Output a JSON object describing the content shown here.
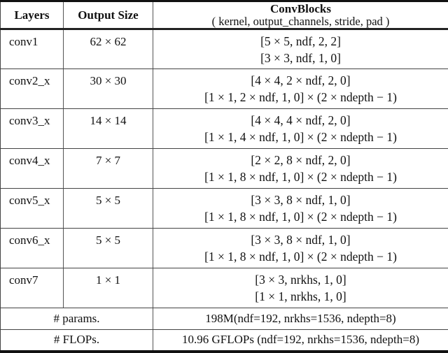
{
  "table": {
    "headers": {
      "layers": "Layers",
      "output_size": "Output Size",
      "convblocks_title": "ConvBlocks",
      "convblocks_subtitle": "( kernel, output_channels, stride, pad )"
    },
    "rows": [
      {
        "layer": "conv1",
        "output_size": "62 × 62",
        "blocks": [
          "[5 × 5, ndf, 2, 2]",
          "[3 × 3, ndf, 1, 0]"
        ]
      },
      {
        "layer": "conv2_x",
        "output_size": "30 × 30",
        "blocks": [
          "[4 × 4, 2 × ndf, 2, 0]",
          "[1 × 1, 2 × ndf, 1, 0] × (2 × ndepth − 1)"
        ]
      },
      {
        "layer": "conv3_x",
        "output_size": "14 × 14",
        "blocks": [
          "[4 × 4, 4 × ndf, 2, 0]",
          "[1 × 1, 4 × ndf, 1, 0] × (2 × ndepth − 1)"
        ]
      },
      {
        "layer": "conv4_x",
        "output_size": "7 × 7",
        "blocks": [
          "[2 × 2, 8 × ndf, 2, 0]",
          "[1 × 1, 8 × ndf, 1, 0] × (2 × ndepth − 1)"
        ]
      },
      {
        "layer": "conv5_x",
        "output_size": "5 × 5",
        "blocks": [
          "[3 × 3, 8 × ndf, 1, 0]",
          "[1 × 1, 8 × ndf, 1, 0] × (2 × ndepth − 1)"
        ]
      },
      {
        "layer": "conv6_x",
        "output_size": "5 × 5",
        "blocks": [
          "[3 × 3, 8 × ndf, 1, 0]",
          "[1 × 1, 8 × ndf, 1, 0] × (2 × ndepth − 1)"
        ]
      },
      {
        "layer": "conv7",
        "output_size": "1 × 1",
        "blocks": [
          "[3 × 3, nrkhs, 1, 0]",
          "[1 × 1, nrkhs, 1, 0]"
        ]
      }
    ],
    "summary": [
      {
        "label": "# params.",
        "value": "198M(ndf=192, nrkhs=1536, ndepth=8)"
      },
      {
        "label": "# FLOPs.",
        "value": "10.96 GFLOPs (ndf=192, nrkhs=1536, ndepth=8)"
      }
    ]
  }
}
